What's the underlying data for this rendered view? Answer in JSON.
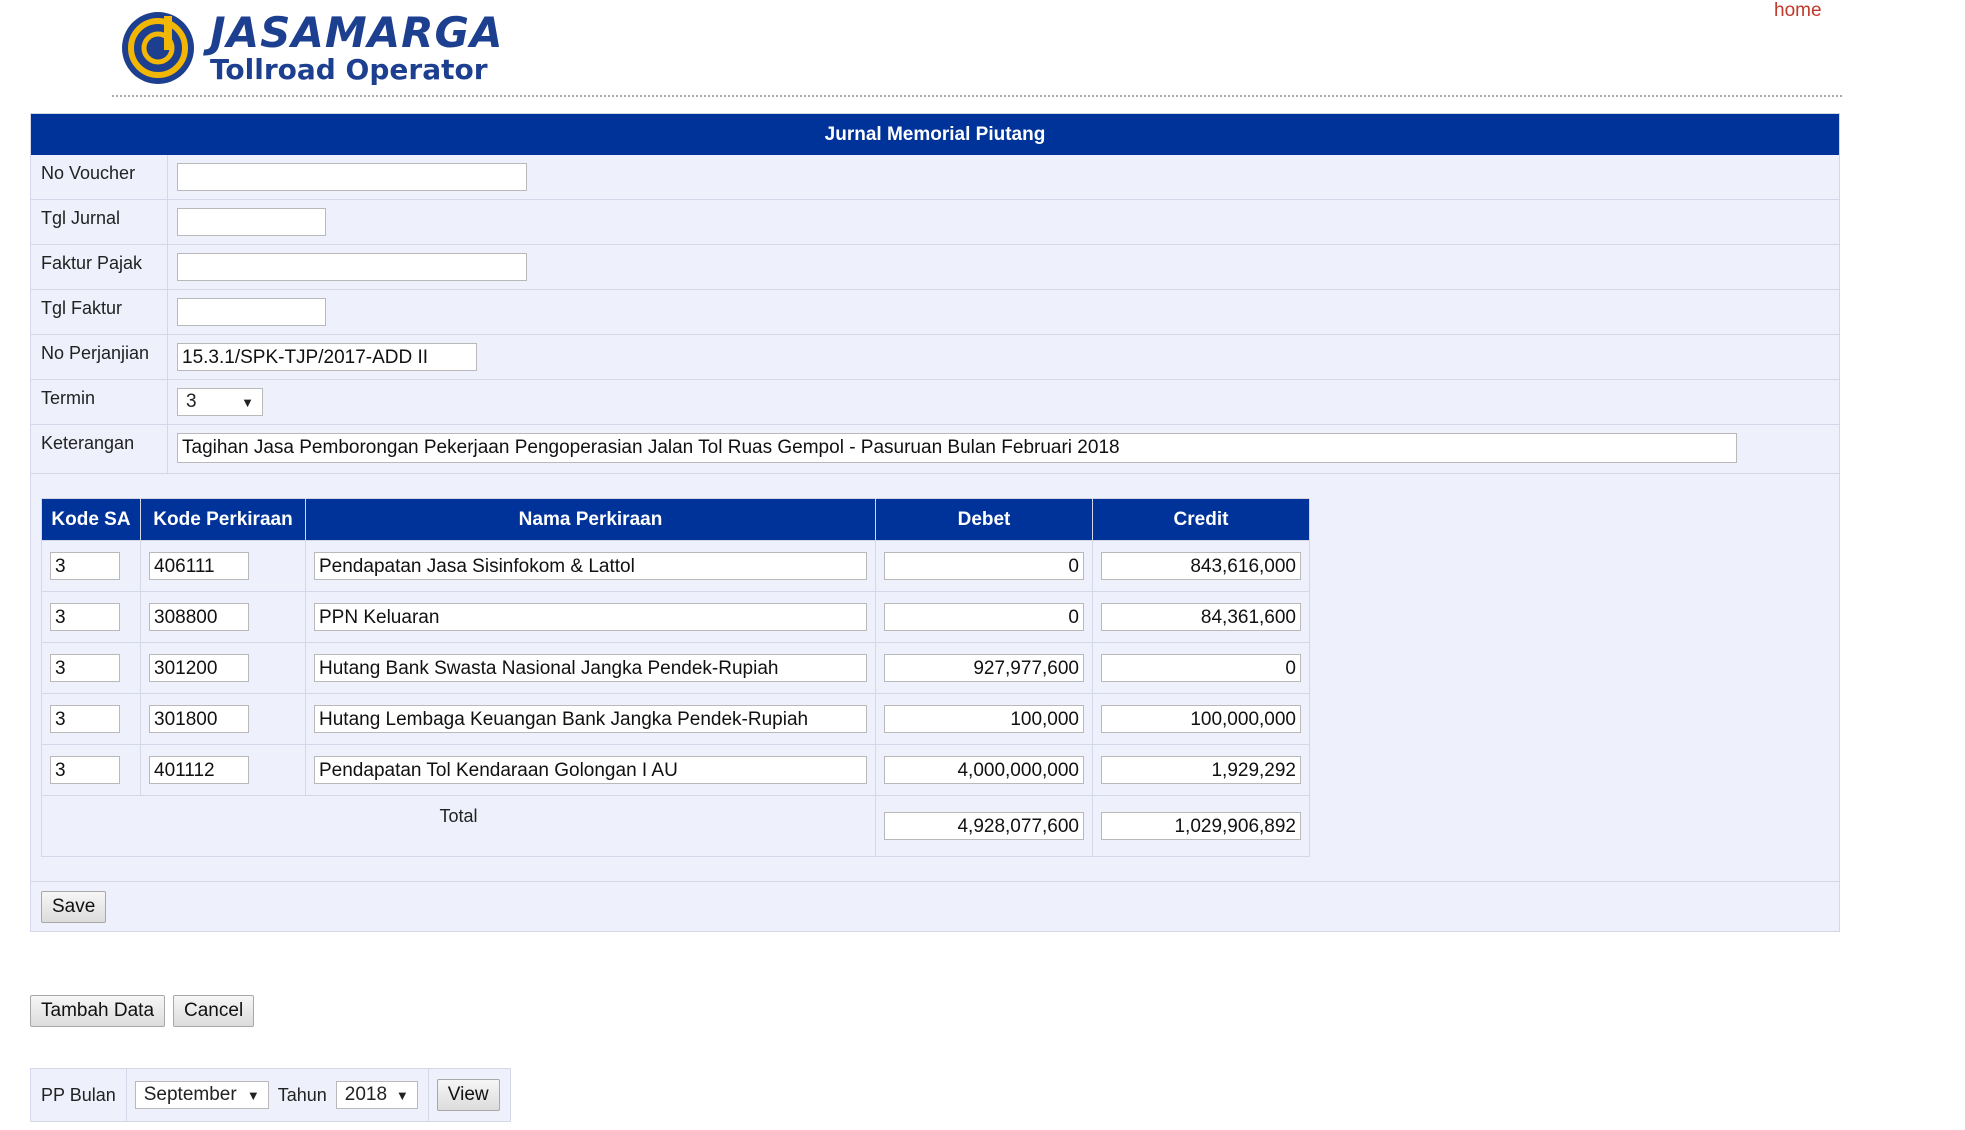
{
  "header": {
    "logo_title": "JASAMARGA",
    "logo_subtitle": "Tollroad Operator",
    "home_link": "home"
  },
  "form": {
    "title": "Jurnal Memorial Piutang",
    "fields": {
      "no_voucher": {
        "label": "No Voucher",
        "value": ""
      },
      "tgl_jurnal": {
        "label": "Tgl Jurnal",
        "value": ""
      },
      "faktur_pajak": {
        "label": "Faktur Pajak",
        "value": ""
      },
      "tgl_faktur": {
        "label": "Tgl Faktur",
        "value": ""
      },
      "no_perjanjian": {
        "label": "No Perjanjian",
        "value": "15.3.1/SPK-TJP/2017-ADD II"
      },
      "termin": {
        "label": "Termin",
        "value": "3"
      },
      "keterangan": {
        "label": "Keterangan",
        "value": "Tagihan Jasa Pemborongan Pekerjaan Pengoperasian Jalan Tol Ruas Gempol - Pasuruan Bulan Februari 2018"
      }
    }
  },
  "detail": {
    "columns": [
      "Kode SA",
      "Kode Perkiraan",
      "Nama Perkiraan",
      "Debet",
      "Credit"
    ],
    "rows": [
      {
        "kode_sa": "3",
        "kode_perkiraan": "406111",
        "nama": "Pendapatan Jasa Sisinfokom & Lattol",
        "debet": "0",
        "credit": "843,616,000"
      },
      {
        "kode_sa": "3",
        "kode_perkiraan": "308800",
        "nama": "PPN Keluaran",
        "debet": "0",
        "credit": "84,361,600"
      },
      {
        "kode_sa": "3",
        "kode_perkiraan": "301200",
        "nama": "Hutang Bank Swasta Nasional Jangka Pendek-Rupiah",
        "debet": "927,977,600",
        "credit": "0"
      },
      {
        "kode_sa": "3",
        "kode_perkiraan": "301800",
        "nama": "Hutang Lembaga Keuangan Bank Jangka Pendek-Rupiah",
        "debet": "100,000",
        "credit": "100,000,000"
      },
      {
        "kode_sa": "3",
        "kode_perkiraan": "401112",
        "nama": "Pendapatan Tol Kendaraan Golongan I AU",
        "debet": "4,000,000,000",
        "credit": "1,929,292"
      }
    ],
    "total_label": "Total",
    "total_debet": "4,928,077,600",
    "total_credit": "1,029,906,892",
    "save_label": "Save"
  },
  "actions": {
    "tambah_label": "Tambah Data",
    "cancel_label": "Cancel"
  },
  "filter": {
    "bulan_label": "PP Bulan",
    "bulan_value": "September",
    "tahun_label": "Tahun",
    "tahun_value": "2018",
    "view_label": "View"
  },
  "colors": {
    "header_blue": "#003399",
    "panel_bg": "#eef0fb",
    "home_link": "#c0392b",
    "brand_blue": "#1d3f8f",
    "brand_yellow": "#f2b705"
  }
}
